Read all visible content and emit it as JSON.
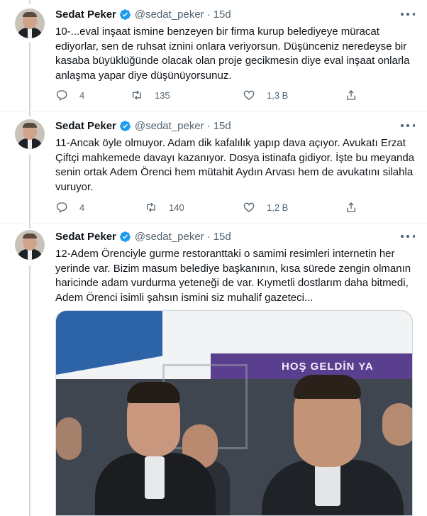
{
  "tweets": [
    {
      "name": "Sedat Peker",
      "handle": "@sedat_peker",
      "time": "15d",
      "text": "10-...eval inşaat ismine benzeyen bir firma kurup belediyeye müracat\nediyorlar, sen de ruhsat iznini onlara veriyorsun. Düşünceniz neredeyse bir\nkasaba büyüklüğünde olacak olan proje gecikmesin diye eval inşaat onlarla\nanlaşma yapar diye düşünüyorsunuz.",
      "replies": "4",
      "retweets": "135",
      "likes": "1,3 B"
    },
    {
      "name": "Sedat Peker",
      "handle": "@sedat_peker",
      "time": "15d",
      "text": "11-Ancak öyle olmuyor. Adam dik kafalılık yapıp dava açıyor. Avukatı Erzat\nÇiftçi mahkemede davayı kazanıyor. Dosya istinafa gidiyor. İşte bu meyanda\nsenin ortak Adem Örenci hem mütahit  Aydın Arvası hem de avukatını silahla\nvuruyor.",
      "replies": "4",
      "retweets": "140",
      "likes": "1,2 B"
    },
    {
      "name": "Sedat Peker",
      "handle": "@sedat_peker",
      "time": "15d",
      "text": "12-Adem Örenciyle gurme restoranttaki o samimi resimleri internetin her\nyerinde var. Bizim masum belediye başkanının, kısa sürede zengin olmanın\nharicinde adam vurdurma yeteneği de var. Kıymetli dostlarım daha bitmedi,\nAdem Örenci isimli şahsın ismini siz muhalif gazeteci..."
    }
  ],
  "media": {
    "banner_text": "HOŞ GELDİN YA"
  },
  "colors": {
    "verified": "#1d9bf0",
    "secondary_text": "#536471",
    "thread_line": "#cfd9de"
  },
  "icons": [
    "verified-badge-icon",
    "more-icon",
    "reply-icon",
    "retweet-icon",
    "like-icon",
    "share-icon"
  ]
}
